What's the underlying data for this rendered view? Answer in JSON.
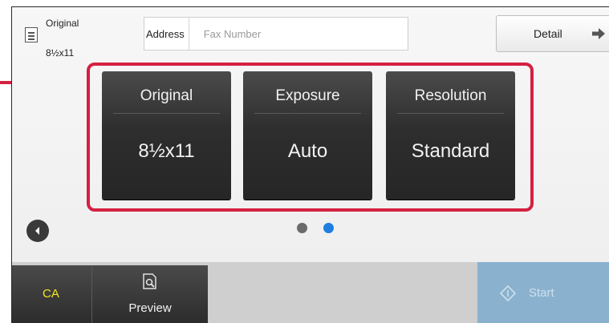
{
  "header": {
    "original_title": "Original",
    "original_size": "8½x11",
    "address_label": "Address",
    "address_placeholder": "Fax Number",
    "address_value": "",
    "detail_label": "Detail"
  },
  "tiles": [
    {
      "title": "Original",
      "value": "8½x11"
    },
    {
      "title": "Exposure",
      "value": "Auto"
    },
    {
      "title": "Resolution",
      "value": "Standard"
    }
  ],
  "pagination": {
    "current_page": 2,
    "total_pages": 2
  },
  "footer": {
    "ca_label": "CA",
    "preview_label": "Preview",
    "start_label": "Start"
  },
  "colors": {
    "highlight": "#d52041",
    "active_dot": "#1f7fe0",
    "inactive_dot": "#6b6b6b",
    "ca_text": "#f5e61a",
    "start_bg": "#8ab2cf",
    "tile_bg": "#2e2e2e"
  },
  "icons": {
    "original": "document-icon",
    "detail": "arrow-right-icon",
    "back": "chevron-left-icon",
    "preview": "magnifier-icon",
    "start": "diamond-icon"
  }
}
